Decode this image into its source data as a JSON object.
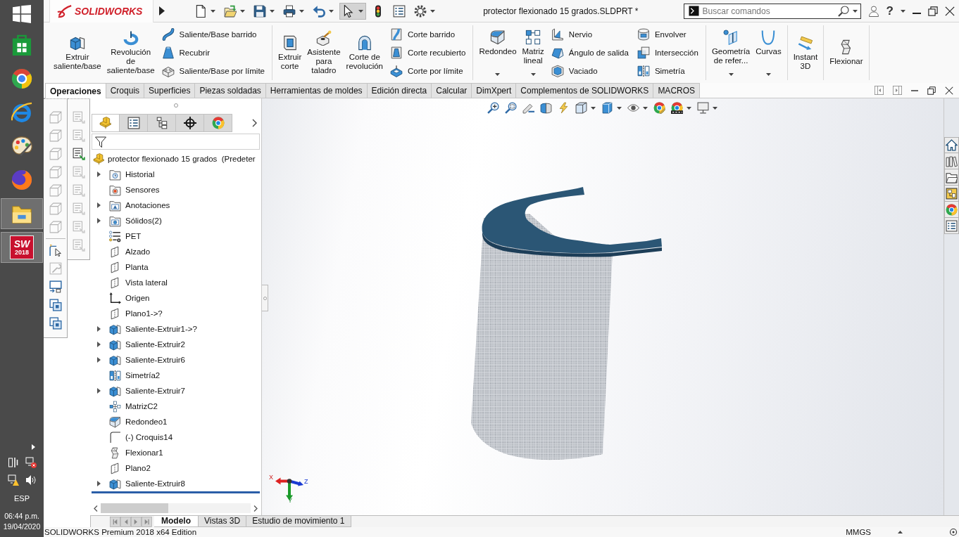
{
  "taskbar": {
    "apps": [
      {
        "kind": "start",
        "open": false
      },
      {
        "kind": "store",
        "open": false
      },
      {
        "kind": "chrome",
        "open": false
      },
      {
        "kind": "ie",
        "open": false
      },
      {
        "kind": "paint",
        "open": false
      },
      {
        "kind": "firefox",
        "open": false
      },
      {
        "kind": "explorer",
        "open": true
      },
      {
        "kind": "solidworks",
        "open": true,
        "label": "SW",
        "badge": "2018"
      }
    ],
    "language": "ESP",
    "time": "06:44 p.m.",
    "date": "19/04/2020"
  },
  "titlebar": {
    "logo": "SOLIDWORKS",
    "quick_access": [
      {
        "kind": "new",
        "dropdown": true,
        "selected": false
      },
      {
        "kind": "open",
        "dropdown": true,
        "selected": false
      },
      {
        "kind": "save",
        "dropdown": true,
        "selected": false
      },
      {
        "kind": "print",
        "dropdown": true,
        "selected": false
      },
      {
        "kind": "undo",
        "dropdown": true,
        "selected": false
      },
      {
        "kind": "select",
        "dropdown": true,
        "selected": true
      },
      {
        "kind": "rebuild",
        "dropdown": false,
        "selected": false
      },
      {
        "kind": "properties",
        "dropdown": false,
        "selected": false
      },
      {
        "kind": "options",
        "dropdown": true,
        "selected": false
      }
    ],
    "title": "protector flexionado 15 grados.SLDPRT *",
    "search": {
      "placeholder": "Buscar comandos"
    },
    "help": "?"
  },
  "ribbon": {
    "groups": [
      {
        "buttons": [
          {
            "kind": "extrude",
            "label": "Extruir\nsaliente/base",
            "dropdown": false
          },
          {
            "kind": "revolve",
            "label": "Revolución\nde\nsaliente/base",
            "dropdown": false
          }
        ],
        "stacks": [
          [
            {
              "kind": "sweep",
              "label": "Saliente/Base barrido"
            },
            {
              "kind": "loft",
              "label": "Recubrir"
            },
            {
              "kind": "boundary",
              "label": "Saliente/Base por límite"
            }
          ]
        ]
      },
      {
        "buttons": [
          {
            "kind": "cutextrude",
            "label": "Extruir\ncorte",
            "dropdown": false
          },
          {
            "kind": "hole",
            "label": "Asistente\npara\ntaladro",
            "dropdown": false
          },
          {
            "kind": "cutrevolve",
            "label": "Corte de\nrevolución",
            "dropdown": false
          }
        ],
        "stacks": [
          [
            {
              "kind": "cutsweep",
              "label": "Corte barrido"
            },
            {
              "kind": "cutloft",
              "label": "Corte recubierto"
            },
            {
              "kind": "cutboundary",
              "label": "Corte por límite"
            }
          ]
        ]
      },
      {
        "buttons": [
          {
            "kind": "fillet",
            "label": "Redondeo",
            "dropdown": true
          },
          {
            "kind": "linpattern",
            "label": "Matriz\nlineal",
            "dropdown": true
          }
        ],
        "stacks": [
          [
            {
              "kind": "rib",
              "label": "Nervio"
            },
            {
              "kind": "draft",
              "label": "Ángulo de salida"
            },
            {
              "kind": "shell",
              "label": "Vaciado"
            }
          ],
          [
            {
              "kind": "wrap",
              "label": "Envolver"
            },
            {
              "kind": "intersect",
              "label": "Intersección"
            },
            {
              "kind": "mirror",
              "label": "Simetría"
            }
          ]
        ]
      },
      {
        "buttons": [
          {
            "kind": "refgeom",
            "label": "Geometría\nde refer...",
            "dropdown": true
          },
          {
            "kind": "curves",
            "label": "Curvas",
            "dropdown": true
          }
        ]
      },
      {
        "buttons": [
          {
            "kind": "instant3d",
            "label": "Instant\n3D",
            "dropdown": false
          }
        ]
      },
      {
        "buttons": [
          {
            "kind": "flex",
            "label": "Flexionar",
            "dropdown": false
          }
        ]
      }
    ]
  },
  "tabs": [
    {
      "label": "Operaciones",
      "selected": true
    },
    {
      "label": "Croquis",
      "selected": false
    },
    {
      "label": "Superficies",
      "selected": false
    },
    {
      "label": "Piezas soldadas",
      "selected": false
    },
    {
      "label": "Herramientas de moldes",
      "selected": false
    },
    {
      "label": "Edición directa",
      "selected": false
    },
    {
      "label": "Calcular",
      "selected": false
    },
    {
      "label": "DimXpert",
      "selected": false
    },
    {
      "label": "Complementos de SOLIDWORKS",
      "selected": false
    },
    {
      "label": "MACROS",
      "selected": false
    }
  ],
  "left_toolbars": [
    {
      "groups": [
        [
          {
            "disabled": true
          },
          {
            "disabled": true
          },
          {
            "disabled": true
          },
          {
            "disabled": true
          },
          {
            "disabled": true
          },
          {
            "disabled": true
          },
          {
            "disabled": true
          }
        ],
        [
          {
            "disabled": false
          },
          {
            "disabled": true
          },
          {
            "disabled": false
          },
          {
            "disabled": false
          },
          {
            "disabled": false
          }
        ]
      ]
    },
    {
      "groups": [
        [
          {
            "disabled": true
          },
          {
            "disabled": true
          },
          {
            "disabled": false
          },
          {
            "disabled": true
          },
          {
            "disabled": true
          },
          {
            "disabled": true
          },
          {
            "disabled": true
          },
          {
            "disabled": true
          }
        ]
      ]
    }
  ],
  "feature_manager": {
    "tabs": [
      {
        "kind": "features",
        "selected": true
      },
      {
        "kind": "properties",
        "selected": false
      },
      {
        "kind": "configurations",
        "selected": false
      },
      {
        "kind": "dimxpert",
        "selected": false
      },
      {
        "kind": "display",
        "selected": false
      }
    ],
    "tree": {
      "kind": "part",
      "label": "protector flexionado 15 grados  (Predeter",
      "children": [
        {
          "kind": "history",
          "label": "Historial",
          "expandable": true
        },
        {
          "kind": "sensors",
          "label": "Sensores",
          "expandable": false
        },
        {
          "kind": "annotations",
          "label": "Anotaciones",
          "expandable": true
        },
        {
          "kind": "solids",
          "label": "Sólidos(2)",
          "expandable": true
        },
        {
          "kind": "material",
          "label": "PET",
          "expandable": false
        },
        {
          "kind": "plane",
          "label": "Alzado",
          "expandable": false
        },
        {
          "kind": "plane",
          "label": "Planta",
          "expandable": false
        },
        {
          "kind": "plane",
          "label": "Vista lateral",
          "expandable": false
        },
        {
          "kind": "origin",
          "label": "Origen",
          "expandable": false
        },
        {
          "kind": "plane",
          "label": "Plano1->?",
          "expandable": false
        },
        {
          "kind": "extrude",
          "label": "Saliente-Extruir1->?",
          "expandable": true
        },
        {
          "kind": "extrude",
          "label": "Saliente-Extruir2",
          "expandable": true
        },
        {
          "kind": "extrude",
          "label": "Saliente-Extruir6",
          "expandable": true
        },
        {
          "kind": "mirror",
          "label": "Simetría2",
          "expandable": false
        },
        {
          "kind": "extrude",
          "label": "Saliente-Extruir7",
          "expandable": true
        },
        {
          "kind": "pattern",
          "label": "MatrizC2",
          "expandable": false
        },
        {
          "kind": "fillet",
          "label": "Redondeo1",
          "expandable": false
        },
        {
          "kind": "sketch",
          "label": "(-) Croquis14",
          "expandable": false
        },
        {
          "kind": "flex",
          "label": "Flexionar1",
          "expandable": false
        },
        {
          "kind": "plane",
          "label": "Plano2",
          "expandable": false
        },
        {
          "kind": "extrude",
          "label": "Saliente-Extruir8",
          "expandable": true
        }
      ]
    }
  },
  "graphics": {
    "triad": {
      "x": "X",
      "y": "Y",
      "z": "Z"
    }
  },
  "bottom_tabs": [
    {
      "label": "Modelo",
      "selected": true
    },
    {
      "label": "Vistas 3D",
      "selected": false
    },
    {
      "label": "Estudio de movimiento 1",
      "selected": false
    }
  ],
  "status_bar": {
    "text": "SOLIDWORKS Premium 2018 x64 Edition",
    "units": "MMGS"
  }
}
